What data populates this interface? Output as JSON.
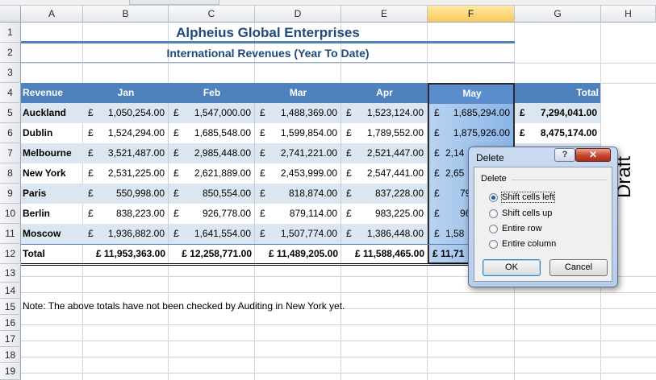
{
  "sheet": {
    "columns": [
      "A",
      "B",
      "C",
      "D",
      "E",
      "F",
      "G",
      "H"
    ],
    "selected_column": "F",
    "rows": [
      "1",
      "2",
      "3",
      "4",
      "5",
      "6",
      "7",
      "8",
      "9",
      "10",
      "11",
      "12",
      "13",
      "14",
      "15",
      "16",
      "17",
      "18",
      "19"
    ]
  },
  "title": "Alpheius Global Enterprises",
  "subtitle": "International Revenues (Year To Date)",
  "table": {
    "headers": {
      "revenue": "Revenue",
      "jan": "Jan",
      "feb": "Feb",
      "mar": "Mar",
      "apr": "Apr",
      "may": "May",
      "total": "Total"
    },
    "currency": "£",
    "rows": [
      {
        "city": "Auckland",
        "jan": "1,050,254.00",
        "feb": "1,547,000.00",
        "mar": "1,488,369.00",
        "apr": "1,523,124.00",
        "may": "1,685,294.00",
        "total": "7,294,041.00"
      },
      {
        "city": "Dublin",
        "jan": "1,524,294.00",
        "feb": "1,685,548.00",
        "mar": "1,599,854.00",
        "apr": "1,789,552.00",
        "may": "1,875,926.00",
        "total": "8,475,174.00"
      },
      {
        "city": "Melbourne",
        "jan": "3,521,487.00",
        "feb": "2,985,448.00",
        "mar": "2,741,221.00",
        "apr": "2,521,447.00",
        "may": "2,14",
        "total": ""
      },
      {
        "city": "New York",
        "jan": "2,531,225.00",
        "feb": "2,621,889.00",
        "mar": "2,453,999.00",
        "apr": "2,547,441.00",
        "may": "2,65",
        "total": ""
      },
      {
        "city": "Paris",
        "jan": "550,998.00",
        "feb": "850,554.00",
        "mar": "818,874.00",
        "apr": "837,228.00",
        "may": "79",
        "total": ""
      },
      {
        "city": "Berlin",
        "jan": "838,223.00",
        "feb": "926,778.00",
        "mar": "879,114.00",
        "apr": "983,225.00",
        "may": "96",
        "total": ""
      },
      {
        "city": "Moscow",
        "jan": "1,936,882.00",
        "feb": "1,641,554.00",
        "mar": "1,507,774.00",
        "apr": "1,386,448.00",
        "may": "1,58",
        "total": ""
      }
    ],
    "total_row": {
      "label": "Total",
      "jan": "£ 11,953,363.00",
      "feb": "£ 12,258,771.00",
      "mar": "£ 11,489,205.00",
      "apr": "£ 11,588,465.00",
      "may": "£ 11,71",
      "total": ""
    }
  },
  "note": "Note: The above totals have not been checked by Auditing in New York yet.",
  "watermark": "Draft",
  "dialog": {
    "title": "Delete",
    "help_label": "?",
    "close_label": "✕",
    "group_label": "Delete",
    "options": [
      "Shift cells left",
      "Shift cells up",
      "Entire row",
      "Entire column"
    ],
    "selected_option": 0,
    "ok_label": "OK",
    "cancel_label": "Cancel"
  }
}
